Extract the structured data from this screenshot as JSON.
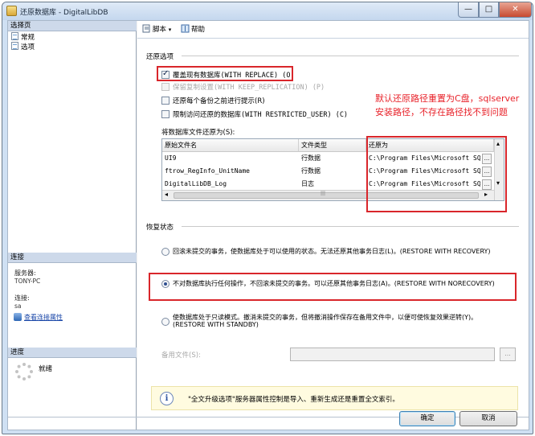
{
  "window": {
    "title": "还原数据库 - DigitalLibDB",
    "min": "—",
    "max": "□",
    "close": "✕"
  },
  "sidebar": {
    "select_page_header": "选择页",
    "pages": [
      {
        "label": "常规"
      },
      {
        "label": "选项"
      }
    ],
    "connection_header": "连接",
    "server_label": "服务器:",
    "server_value": "TONY-PC",
    "connection_label": "连接:",
    "connection_value": "sa",
    "view_props_link": "查看连接属性",
    "progress_header": "进度",
    "progress_status": "就绪"
  },
  "toolbar": {
    "script_label": "脚本",
    "script_arrow": "▾",
    "help_label": "帮助"
  },
  "restore_options": {
    "group_title": "还原选项",
    "options": [
      {
        "label": "覆盖现有数据库(WITH REPLACE) (O)",
        "checked": true,
        "enabled": true
      },
      {
        "label": "保留复制设置(WITH KEEP_REPLICATION) (P)",
        "checked": false,
        "enabled": false
      },
      {
        "label": "还原每个备份之前进行提示(R)",
        "checked": false,
        "enabled": true
      },
      {
        "label": "限制访问还原的数据库(WITH RESTRICTED_USER) (C)",
        "checked": false,
        "enabled": true
      }
    ],
    "restore_as_label": "将数据库文件还原为(S):",
    "columns": [
      "原始文件名",
      "文件类型",
      "还原为"
    ],
    "files": [
      {
        "name": "UI9",
        "type": "行数据",
        "path": "C:\\Program Files\\Microsoft SQL S..."
      },
      {
        "name": "ftrow_RegInfo_UnitName",
        "type": "行数据",
        "path": "C:\\Program Files\\Microsoft SQL S..."
      },
      {
        "name": "DigitalLibDB_Log",
        "type": "日志",
        "path": "C:\\Program Files\\Microsoft SQL S..."
      }
    ],
    "browse_label": "...",
    "scroll_left": "◂",
    "scroll_right": "▸",
    "scroll_up": "▴",
    "scroll_down": "▾",
    "scroll_grip": "|||"
  },
  "annotation": {
    "text": "默认还原路径重置为C盘，sqlserver安装路径，不存在路径找不到问题",
    "color": "#e8222a"
  },
  "recovery_state": {
    "group_title": "恢复状态",
    "options": [
      {
        "label": "回滚未提交的事务，使数据库处于可以使用的状态。无法还原其他事务日志(L)。(RESTORE WITH RECOVERY)",
        "selected": false
      },
      {
        "label": "不对数据库执行任何操作，不回滚未提交的事务。可以还原其他事务日志(A)。(RESTORE WITH NORECOVERY)",
        "selected": true
      },
      {
        "label": "使数据库处于只读模式。撤消未提交的事务，但将撤消操作保存在备用文件中，以便可使恢复效果逆转(Y)。",
        "label2": "(RESTORE WITH STANDBY)",
        "selected": false
      }
    ],
    "standby_file_label": "备用文件(S):",
    "standby_file_value": "",
    "standby_browse": "..."
  },
  "info": {
    "icon": "i",
    "text": "\"全文升级选项\"服务器属性控制是导入、重新生成还是重置全文索引。"
  },
  "footer": {
    "ok_label": "确定",
    "cancel_label": "取消"
  }
}
